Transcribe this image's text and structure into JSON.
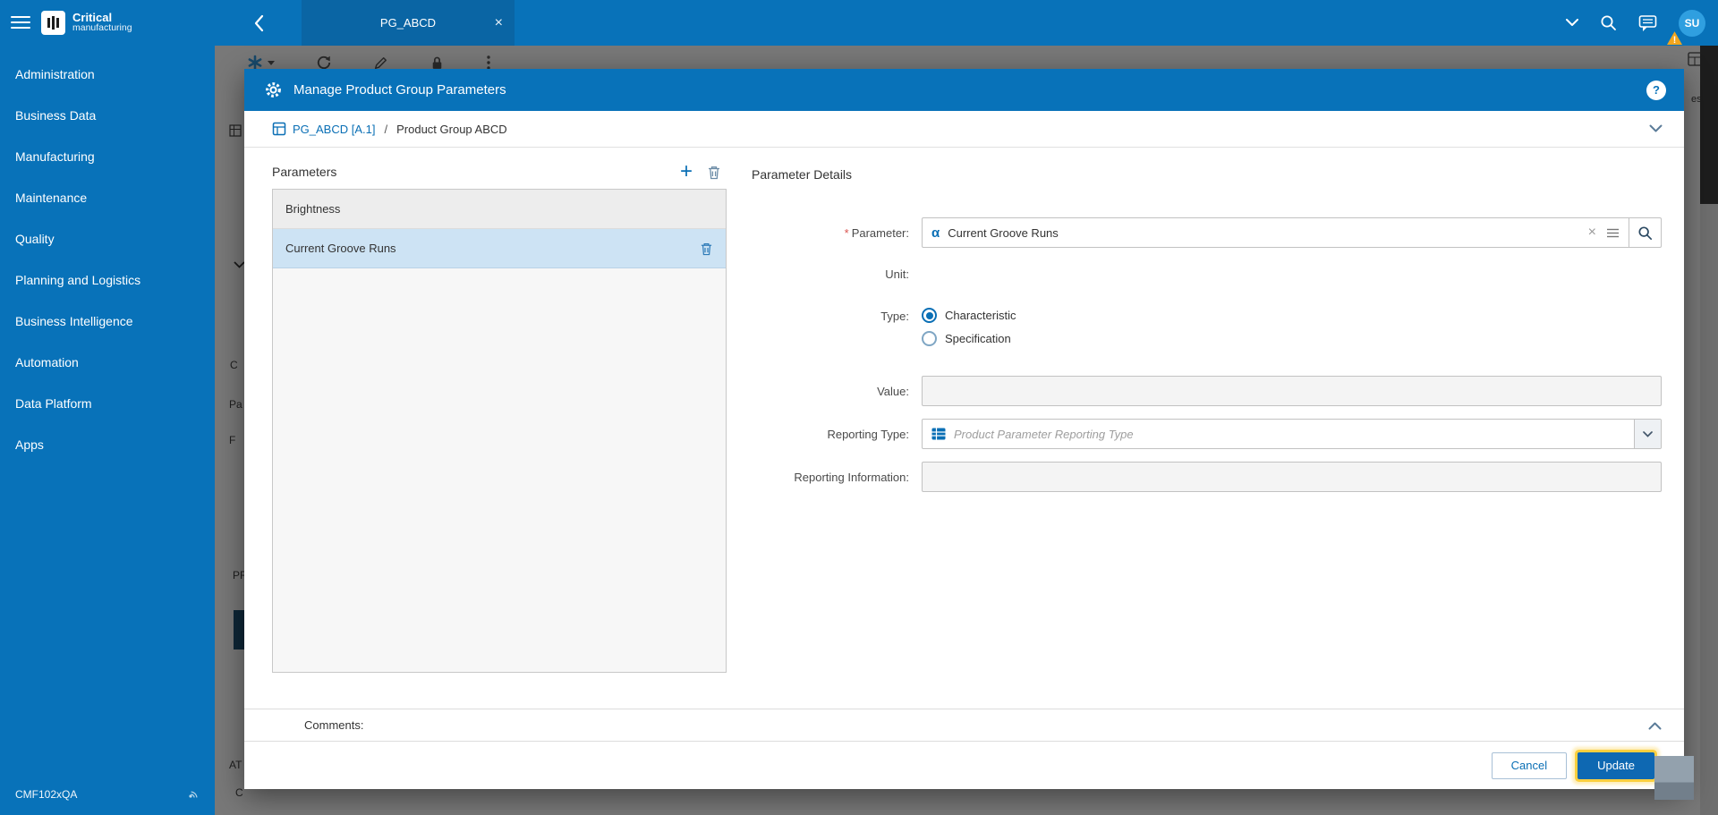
{
  "brand": {
    "line1": "Critical",
    "line2": "manufacturing"
  },
  "sidebar": {
    "items": [
      {
        "label": "Administration"
      },
      {
        "label": "Business Data"
      },
      {
        "label": "Manufacturing"
      },
      {
        "label": "Maintenance"
      },
      {
        "label": "Quality"
      },
      {
        "label": "Planning and Logistics"
      },
      {
        "label": "Business Intelligence"
      },
      {
        "label": "Automation"
      },
      {
        "label": "Data Platform"
      },
      {
        "label": "Apps"
      }
    ],
    "environment": "CMF102xQA"
  },
  "topbar": {
    "tab_label": "PG_ABCD",
    "avatar": "SU"
  },
  "glyphs": {
    "close": "×",
    "plus": "+",
    "alpha": "α",
    "help": "?",
    "required": "*"
  },
  "modal": {
    "title": "Manage Product Group Parameters",
    "breadcrumb": {
      "link": "PG_ABCD [A.1]",
      "separator": "/",
      "current": "Product Group ABCD"
    },
    "parameters": {
      "title": "Parameters",
      "items": [
        {
          "label": "Brightness",
          "selected": false
        },
        {
          "label": "Current Groove Runs",
          "selected": true
        }
      ]
    },
    "details": {
      "title": "Parameter Details",
      "fields": {
        "parameter": {
          "label": "Parameter:",
          "required": true,
          "value": "Current Groove Runs"
        },
        "unit": {
          "label": "Unit:",
          "value": ""
        },
        "type": {
          "label": "Type:",
          "options": [
            {
              "label": "Characteristic",
              "selected": true
            },
            {
              "label": "Specification",
              "selected": false
            }
          ]
        },
        "value": {
          "label": "Value:",
          "value": ""
        },
        "reporting_type": {
          "label": "Reporting Type:",
          "placeholder": "Product Parameter Reporting Type"
        },
        "reporting_information": {
          "label": "Reporting Information:",
          "value": ""
        }
      }
    },
    "comments_label": "Comments:",
    "footer": {
      "cancel": "Cancel",
      "update": "Update"
    }
  },
  "background": {
    "fragments": {
      "f1": "C",
      "f2": "Pa",
      "f3": "F",
      "f4": "PR",
      "f5": "AT",
      "f6": "C",
      "f7": "es"
    }
  },
  "colors": {
    "primary": "#0872b9",
    "tab": "#0a65a4",
    "selected_item": "#cde3f4",
    "link": "#0a6fb5",
    "focus_ring": "#fbcf3f"
  }
}
